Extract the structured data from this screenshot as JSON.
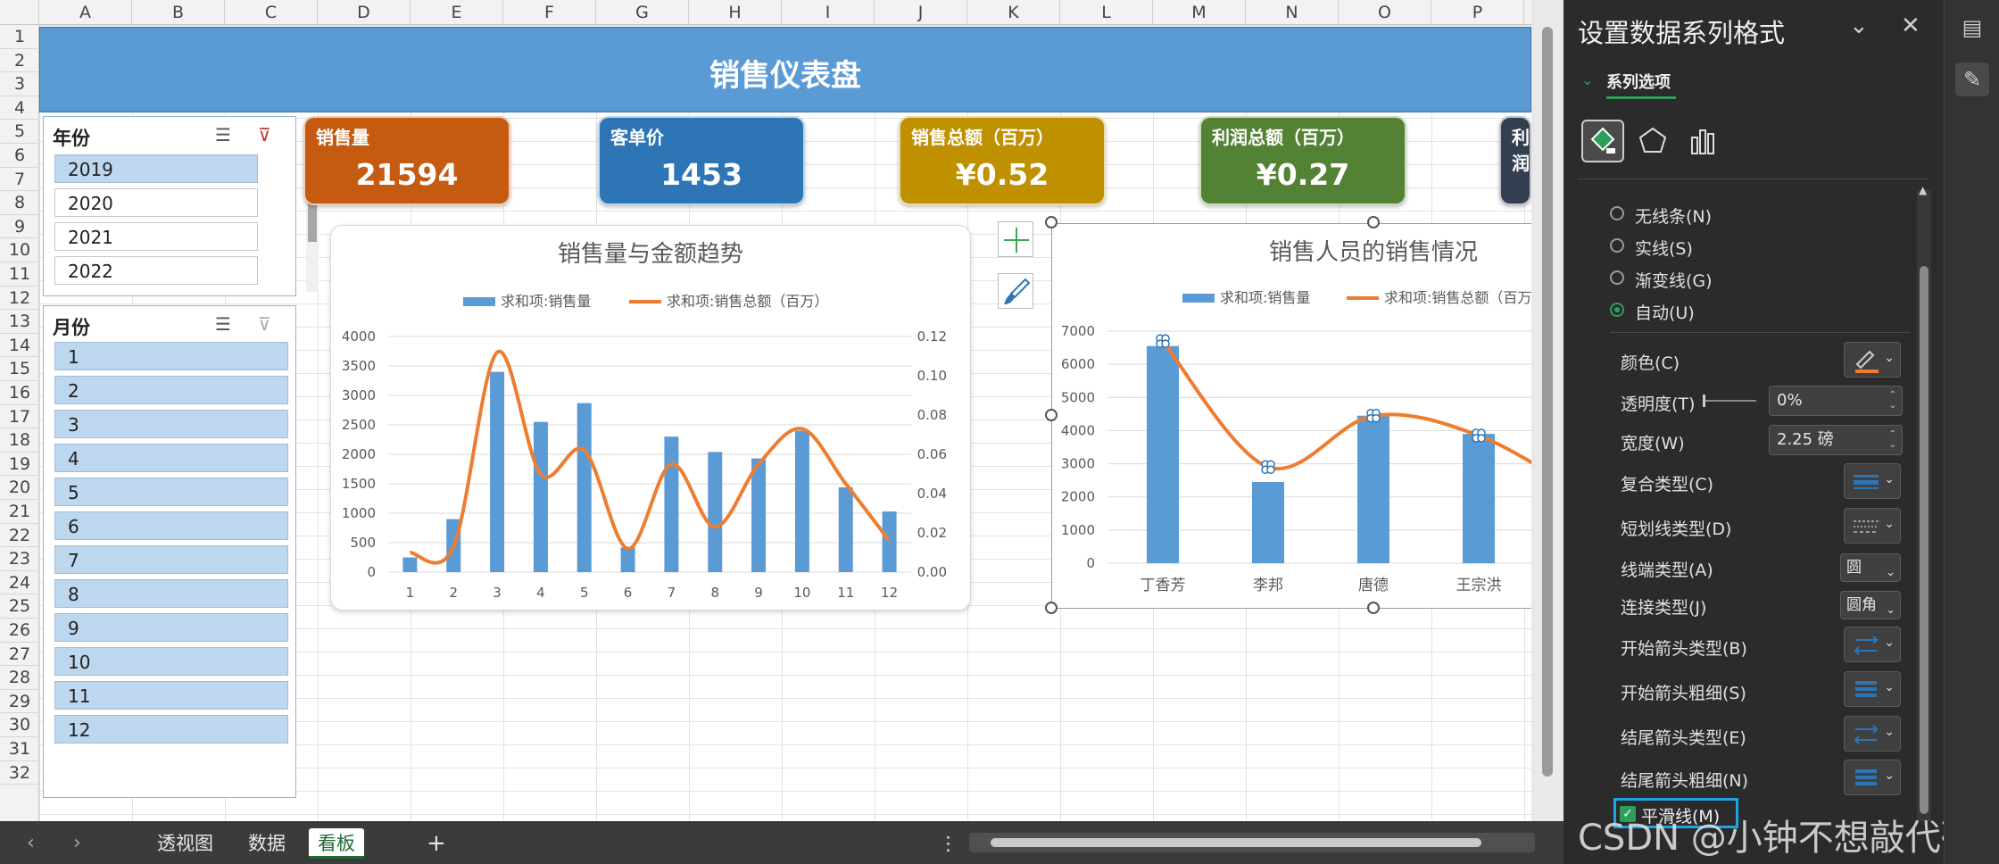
{
  "sheet": {
    "columns": [
      "A",
      "B",
      "C",
      "D",
      "E",
      "F",
      "G",
      "H",
      "I",
      "J",
      "K",
      "L",
      "M",
      "N",
      "O",
      "P"
    ],
    "rows": [
      "1",
      "2",
      "3",
      "4",
      "5",
      "6",
      "7",
      "8",
      "9",
      "10",
      "11",
      "12",
      "13",
      "14",
      "15",
      "16",
      "17",
      "18",
      "19",
      "20",
      "21",
      "22",
      "23",
      "24",
      "25",
      "26",
      "27",
      "28",
      "29",
      "30",
      "31",
      "32"
    ]
  },
  "dashboard": {
    "title": "销售仪表盘"
  },
  "slicer_year": {
    "title": "年份",
    "items": [
      "2019",
      "2020",
      "2021",
      "2022"
    ],
    "selected": "2019"
  },
  "slicer_month": {
    "title": "月份",
    "items": [
      "1",
      "2",
      "3",
      "4",
      "5",
      "6",
      "7",
      "8",
      "9",
      "10",
      "11",
      "12"
    ]
  },
  "kpis": [
    {
      "label": "销售量",
      "value": "21594",
      "color": "#c55a11"
    },
    {
      "label": "客单价",
      "value": "1453",
      "color": "#2e75b6"
    },
    {
      "label": "销售总额（百万）",
      "value": "¥0.52",
      "color": "#bf9000"
    },
    {
      "label": "利润总额（百万）",
      "value": "¥0.27",
      "color": "#548235"
    },
    {
      "label": "利润",
      "value": "",
      "color": "#333f50"
    }
  ],
  "chart_data": [
    {
      "type": "bar",
      "title": "销售量与金额趋势",
      "categories": [
        "1",
        "2",
        "3",
        "4",
        "5",
        "6",
        "7",
        "8",
        "9",
        "10",
        "11",
        "12"
      ],
      "series": [
        {
          "name": "求和项:销售量",
          "type": "bar",
          "axis": "left",
          "color": "#5b9bd5",
          "values": [
            250,
            900,
            3400,
            2550,
            2870,
            420,
            2300,
            2040,
            1930,
            2400,
            1440,
            1030
          ]
        },
        {
          "name": "求和项:销售总额（百万）",
          "type": "line",
          "smooth": true,
          "axis": "right",
          "color": "#ed7d31",
          "values": [
            0.01,
            0.013,
            0.112,
            0.05,
            0.062,
            0.012,
            0.055,
            0.023,
            0.055,
            0.073,
            0.045,
            0.016
          ]
        }
      ],
      "ylim": [
        0,
        4000
      ],
      "yticks": [
        "0",
        "500",
        "1000",
        "1500",
        "2000",
        "2500",
        "3000",
        "3500",
        "4000"
      ],
      "y2lim": [
        0,
        0.12
      ],
      "y2ticks": [
        "0.00",
        "0.02",
        "0.04",
        "0.06",
        "0.08",
        "0.10",
        "0.12"
      ],
      "legend": "top"
    },
    {
      "type": "bar",
      "title": "销售人员的销售情况",
      "categories": [
        "丁香芳",
        "李邦",
        "唐德",
        "王宗洪"
      ],
      "series": [
        {
          "name": "求和项:销售量",
          "type": "bar",
          "color": "#5b9bd5",
          "values": [
            6550,
            2450,
            4450,
            3900
          ]
        },
        {
          "name": "求和项:销售总额（百万）",
          "type": "line",
          "smooth": true,
          "color": "#ed7d31",
          "values": [
            6700,
            2900,
            4450,
            3850
          ]
        }
      ],
      "ylim": [
        0,
        7000
      ],
      "yticks": [
        "0",
        "1000",
        "2000",
        "3000",
        "4000",
        "5000",
        "6000",
        "7000"
      ],
      "legend": "top"
    }
  ],
  "tabs": {
    "items": [
      "透视图",
      "数据",
      "看板"
    ],
    "active": "看板",
    "add": "+",
    "more": "⋮"
  },
  "pane": {
    "title": "设置数据系列格式",
    "section": "系列选项",
    "line_options": [
      "无线条(N)",
      "实线(S)",
      "渐变线(G)",
      "自动(U)"
    ],
    "line_selected": "自动(U)",
    "props": {
      "color": "颜色(C)",
      "transparency": "透明度(T)",
      "transparency_value": "0%",
      "width": "宽度(W)",
      "width_value": "2.25 磅",
      "compound": "复合类型(C)",
      "dash": "短划线类型(D)",
      "cap": "线端类型(A)",
      "cap_value": "圆",
      "join": "连接类型(J)",
      "join_value": "圆角",
      "begin_arrow": "开始箭头类型(B)",
      "begin_arrow_size": "开始箭头粗细(S)",
      "end_arrow": "结尾箭头类型(E)",
      "end_arrow_size": "结尾箭头粗细(N)"
    },
    "smooth": {
      "label": "平滑线(M)",
      "checked": true
    }
  },
  "watermark": "CSDN @小钟不想敲代码",
  "colors": {
    "accent": "#2e9e5b",
    "bar": "#5b9bd5",
    "line": "#ed7d31",
    "banner": "#5b9bd5"
  }
}
